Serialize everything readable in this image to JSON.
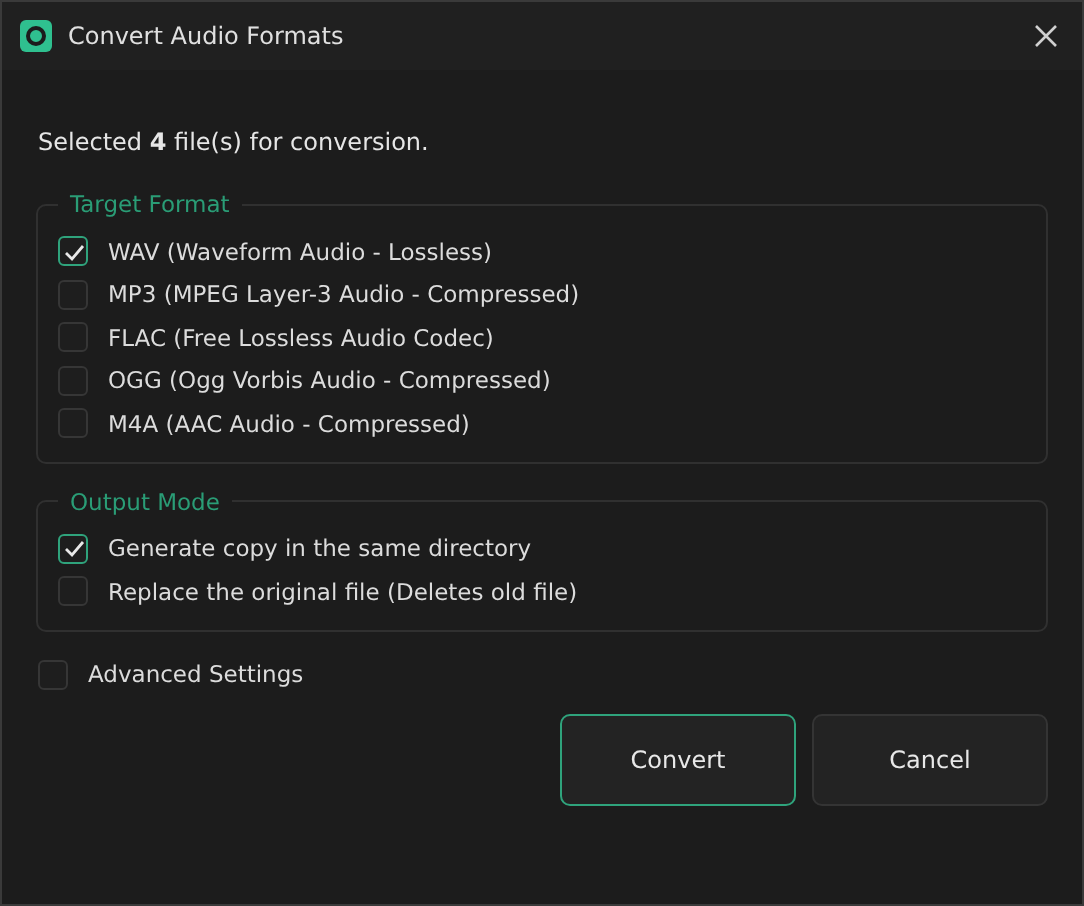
{
  "window": {
    "title": "Convert Audio Formats"
  },
  "intro": "Selected **4** file(s) for conversion.",
  "groups": [
    {
      "legend": "Target Format",
      "options": [
        {
          "label": "WAV (Waveform Audio - Lossless)",
          "checked": true
        },
        {
          "label": "MP3 (MPEG Layer-3 Audio - Compressed)",
          "checked": false
        },
        {
          "label": "FLAC (Free Lossless Audio Codec)",
          "checked": false
        },
        {
          "label": "OGG (Ogg Vorbis Audio - Compressed)",
          "checked": false
        },
        {
          "label": "M4A (AAC Audio - Compressed)",
          "checked": false
        }
      ]
    },
    {
      "legend": "Output Mode",
      "options": [
        {
          "label": "Generate copy in the same directory",
          "checked": true
        },
        {
          "label": "Replace the original file (Deletes old file)",
          "checked": false
        }
      ]
    }
  ],
  "advanced": {
    "label": "Advanced Settings",
    "checked": false
  },
  "buttons": [
    {
      "label": "Convert",
      "kind": "primary"
    },
    {
      "label": "Cancel",
      "kind": "default"
    }
  ]
}
